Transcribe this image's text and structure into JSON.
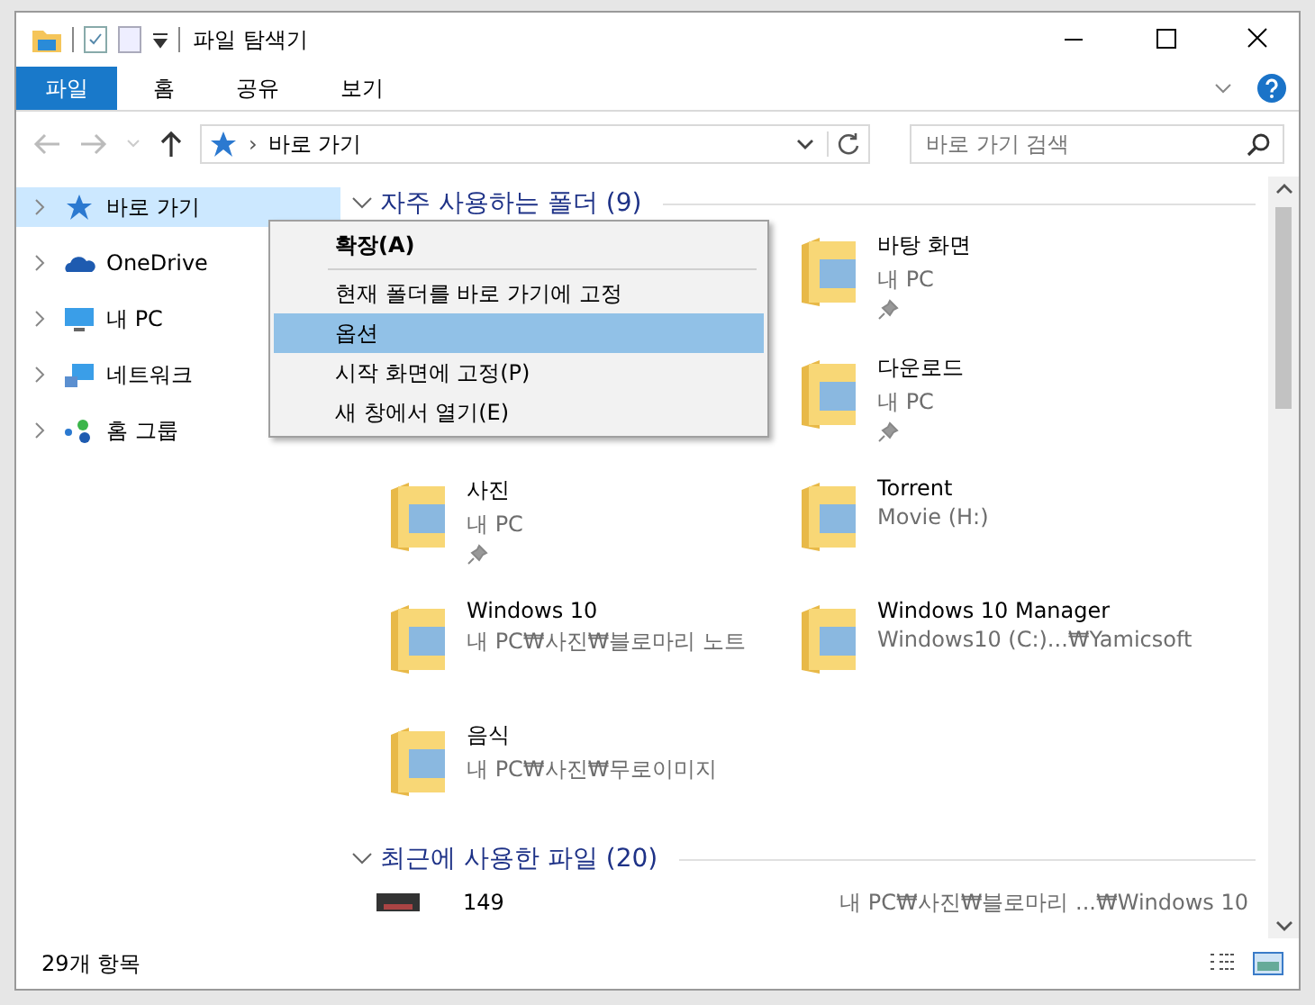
{
  "window": {
    "title": "파일 탐색기"
  },
  "ribbon_tabs": [
    {
      "label": "파일",
      "kind": "file"
    },
    {
      "label": "홈",
      "kind": "tab"
    },
    {
      "label": "공유",
      "kind": "tab"
    },
    {
      "label": "보기",
      "kind": "tab"
    }
  ],
  "address_bar": {
    "separator": "›",
    "path": "바로 가기"
  },
  "search": {
    "placeholder": "바로 가기 검색"
  },
  "nav_tree": [
    {
      "label": "바로 가기",
      "kind": "quick-access",
      "selected": true,
      "expanded": false
    },
    {
      "label": "OneDrive",
      "kind": "cloud",
      "selected": false,
      "expanded": false
    },
    {
      "label": "내 PC",
      "kind": "pc",
      "selected": false,
      "expanded": false
    },
    {
      "label": "네트워크",
      "kind": "network",
      "selected": false,
      "expanded": false
    },
    {
      "label": "홈 그룹",
      "kind": "homegroup",
      "selected": false,
      "expanded": false
    }
  ],
  "frequent_folders": {
    "header": "자주 사용하는 폴더 (9)",
    "expanded": true,
    "items": [
      {
        "kind": "covered"
      },
      {
        "kind": "folder",
        "name": "바탕 화면",
        "location": "내 PC",
        "pinned": true
      },
      {
        "kind": "covered"
      },
      {
        "kind": "folder",
        "name": "다운로드",
        "location": "내 PC",
        "pinned": true
      },
      {
        "kind": "folder",
        "name": "사진",
        "location": "내 PC",
        "pinned": true
      },
      {
        "kind": "folder",
        "name": "Torrent",
        "location": "Movie (H:)",
        "pinned": false
      },
      {
        "kind": "folder",
        "name": "Windows 10",
        "location": "내 PC₩사진₩블로마리 노트",
        "pinned": false
      },
      {
        "kind": "folder",
        "name": "Windows 10 Manager",
        "location": "Windows10 (C:)...₩Yamicsoft",
        "pinned": false
      },
      {
        "kind": "folder",
        "name": "음식",
        "location": "내 PC₩사진₩무로이미지",
        "pinned": false
      }
    ]
  },
  "recent_files": {
    "header": "최근에 사용한 파일 (20)",
    "expanded": true,
    "items": [
      {
        "name": "149",
        "location": "내 PC₩사진₩블로마리 ...₩Windows 10"
      }
    ]
  },
  "context_menu": [
    {
      "label": "확장(A)",
      "kind": "default",
      "selected": false
    },
    {
      "kind": "separator"
    },
    {
      "label": "현재 폴더를 바로 가기에 고정",
      "kind": "item",
      "selected": false
    },
    {
      "label": "옵션",
      "kind": "item",
      "selected": true
    },
    {
      "label": "시작 화면에 고정(P)",
      "kind": "item",
      "selected": false
    },
    {
      "label": "새 창에서 열기(E)",
      "kind": "item",
      "selected": false
    }
  ],
  "status_bar": {
    "item_count": "29개 항목"
  }
}
